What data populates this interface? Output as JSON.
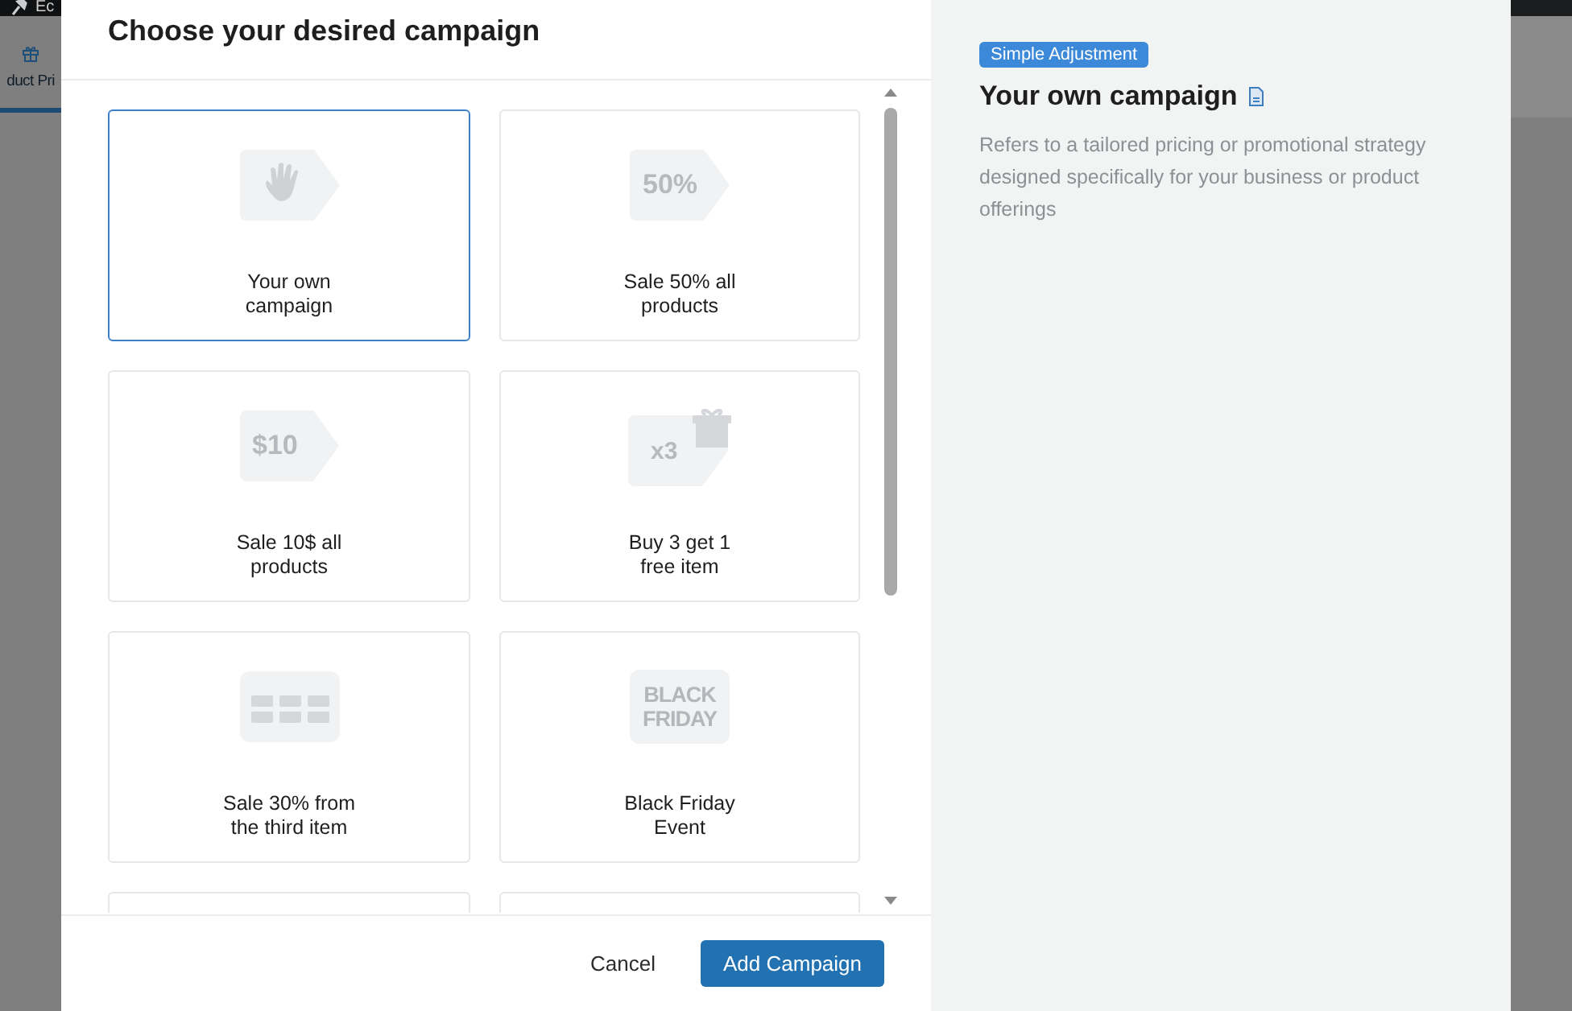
{
  "background": {
    "admin_bar_text": "Ec",
    "tab_label": "duct Pri"
  },
  "dialog": {
    "title": "Choose your desired campaign",
    "card_rows": [
      {
        "cards": [
          {
            "kind": "hand",
            "label": "Your own\ncampaign",
            "selected": true
          },
          {
            "kind": "tag",
            "label": "Sale 50% all\nproducts",
            "icon_text": "50%",
            "selected": false
          }
        ]
      },
      {
        "cards": [
          {
            "kind": "tag",
            "label": "Sale 10$ all\nproducts",
            "icon_text": "$10",
            "selected": false
          },
          {
            "kind": "gift",
            "label": "Buy 3 get 1\nfree item",
            "icon_text": "x3",
            "selected": false
          }
        ]
      },
      {
        "cards": [
          {
            "kind": "grid",
            "label": "Sale 30% from\nthe third item",
            "selected": false
          },
          {
            "kind": "calendar",
            "label": "Black Friday\nEvent",
            "icon_text": "BLACK\nFRIDAY",
            "selected": false
          }
        ]
      }
    ],
    "buttons": {
      "cancel": "Cancel",
      "primary": "Add Campaign"
    },
    "detail": {
      "badge": "Simple Adjustment",
      "title": "Your own campaign",
      "description": "Refers to a tailored pricing or promotional strategy designed specifically for your business or product offerings"
    }
  }
}
